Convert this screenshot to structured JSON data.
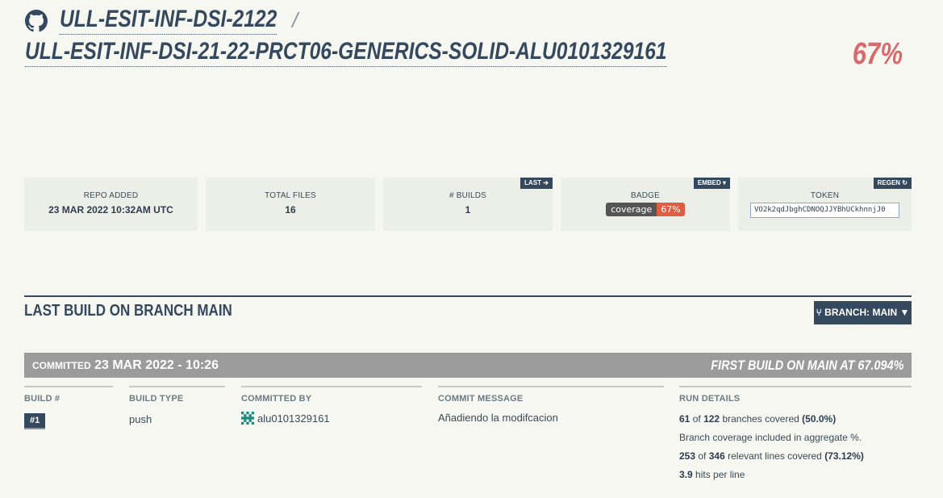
{
  "header": {
    "org": "ULL-ESIT-INF-DSI-2122",
    "separator": "/",
    "repo": "ULL-ESIT-INF-DSI-21-22-PRCT06-GENERICS-SOLID-ALU0101329161",
    "coverage_percent": "67%"
  },
  "stats": {
    "repo_added_label": "REPO ADDED",
    "repo_added_value": "23 MAR 2022 10:32AM UTC",
    "total_files_label": "TOTAL FILES",
    "total_files_value": "16",
    "builds_label": "# BUILDS",
    "builds_value": "1",
    "builds_tag": "LAST",
    "badge_label": "BADGE",
    "badge_tag": "EMBED",
    "badge_left": "coverage",
    "badge_right": "67%",
    "token_label": "TOKEN",
    "token_tag": "REGEN",
    "token_value": "VO2k2qdJbghCDNOQJJYBhUCkhnnjJ0"
  },
  "last_build": {
    "title": "LAST BUILD ON BRANCH MAIN",
    "branch_button": "BRANCH: MAIN",
    "committed_label": "COMMITTED",
    "committed_value": "23 MAR 2022 - 10:26",
    "first_build": "FIRST BUILD ON MAIN AT 67.094%",
    "columns": {
      "build_num_head": "BUILD #",
      "build_num": "#1",
      "build_type_head": "BUILD TYPE",
      "build_type": "push",
      "committed_by_head": "COMMITTED BY",
      "committed_by": "alu0101329161",
      "commit_msg_head": "COMMIT MESSAGE",
      "commit_msg": "Añadiendo la modifcacion",
      "run_details_head": "RUN DETAILS"
    },
    "run_details": {
      "branches_covered": "61",
      "of1": "of",
      "branches_total": "122",
      "branches_text": "branches covered",
      "branches_pct": "(50.0%)",
      "aggregate_note": "Branch coverage included in aggregate %.",
      "lines_covered": "253",
      "of2": "of",
      "lines_total": "346",
      "lines_text": "relevant lines covered",
      "lines_pct": "(73.12%)",
      "hits": "3.9",
      "hits_text": "hits per line"
    }
  },
  "colors": {
    "primary": "#34495e",
    "coverage_red": "#d9696b",
    "bar_gray": "#9b9b9b"
  }
}
